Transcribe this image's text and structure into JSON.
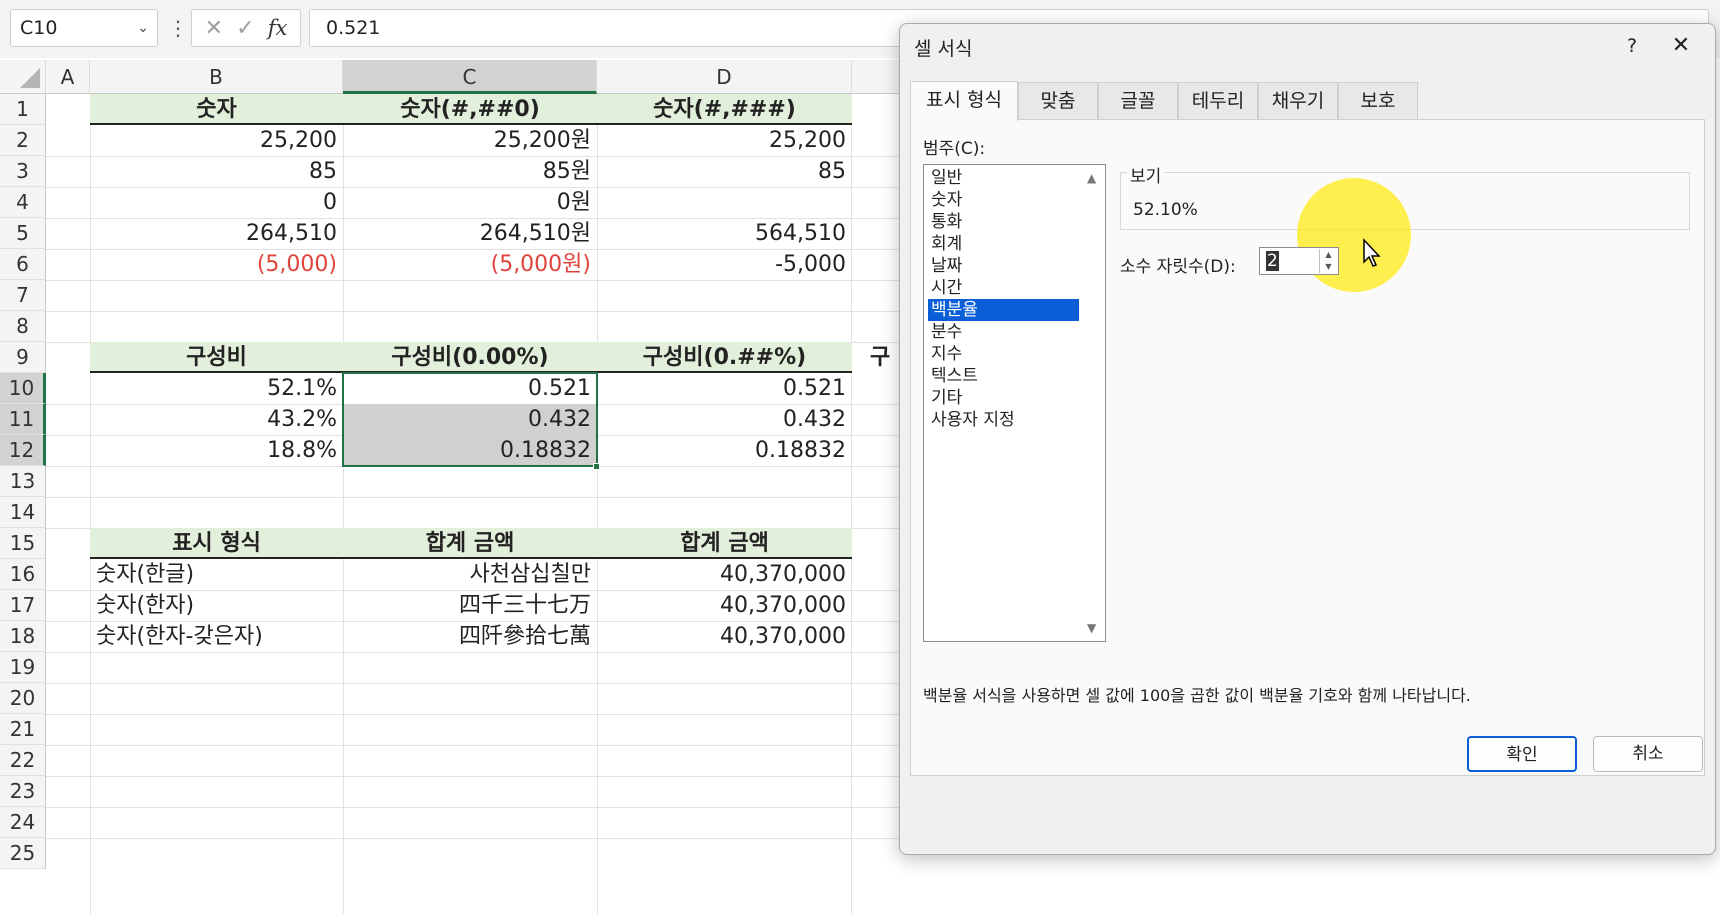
{
  "formula_bar": {
    "name_box": "C10",
    "value": "0.521",
    "fx_label": "fx"
  },
  "grid": {
    "columns": [
      "A",
      "B",
      "C",
      "D"
    ],
    "rows": [
      "1",
      "2",
      "3",
      "4",
      "5",
      "6",
      "7",
      "8",
      "9",
      "10",
      "11",
      "12",
      "13",
      "14",
      "15",
      "16",
      "17",
      "18",
      "19",
      "20",
      "21",
      "22",
      "23",
      "24",
      "25"
    ],
    "header_row1": [
      "숫자",
      "숫자(#,##0)",
      "숫자(#,###)"
    ],
    "table1": [
      [
        "25,200",
        "25,200원",
        "25,200"
      ],
      [
        "85",
        "85원",
        "85"
      ],
      [
        "0",
        "0원",
        ""
      ],
      [
        "264,510",
        "264,510원",
        "564,510"
      ],
      [
        "(5,000)",
        "(5,000원)",
        "-5,000"
      ]
    ],
    "header_row9": [
      "구성비",
      "구성비(0.00%)",
      "구성비(0.##%)",
      "구"
    ],
    "table2": [
      [
        "52.1%",
        "0.521",
        "0.521"
      ],
      [
        "43.2%",
        "0.432",
        "0.432"
      ],
      [
        "18.8%",
        "0.18832",
        "0.18832"
      ]
    ],
    "header_row15": [
      "표시 형식",
      "합계 금액",
      "합계 금액"
    ],
    "table3": [
      [
        "숫자(한글)",
        "사천삼십칠만",
        "40,370,000"
      ],
      [
        "숫자(한자)",
        "四千三十七万",
        "40,370,000"
      ],
      [
        "숫자(한자-갖은자)",
        "四阡參拾七萬",
        "40,370,000"
      ]
    ]
  },
  "dialog": {
    "title": "셀 서식",
    "help": "?",
    "close": "✕",
    "tabs": [
      "표시 형식",
      "맞춤",
      "글꼴",
      "테두리",
      "채우기",
      "보호"
    ],
    "category_label": "범주(C):",
    "categories": [
      "일반",
      "숫자",
      "통화",
      "회계",
      "날짜",
      "시간",
      "백분율",
      "분수",
      "지수",
      "텍스트",
      "기타",
      "사용자 지정"
    ],
    "selected_category": "백분율",
    "preview_label": "보기",
    "preview_value": "52.10%",
    "decimal_label": "소수 자릿수(D):",
    "decimal_value": "2",
    "description": "백분율 서식을 사용하면 셀 값에 100을 곱한 값이 백분율 기호와 함께 나타납니다.",
    "ok_label": "확인",
    "cancel_label": "취소"
  }
}
